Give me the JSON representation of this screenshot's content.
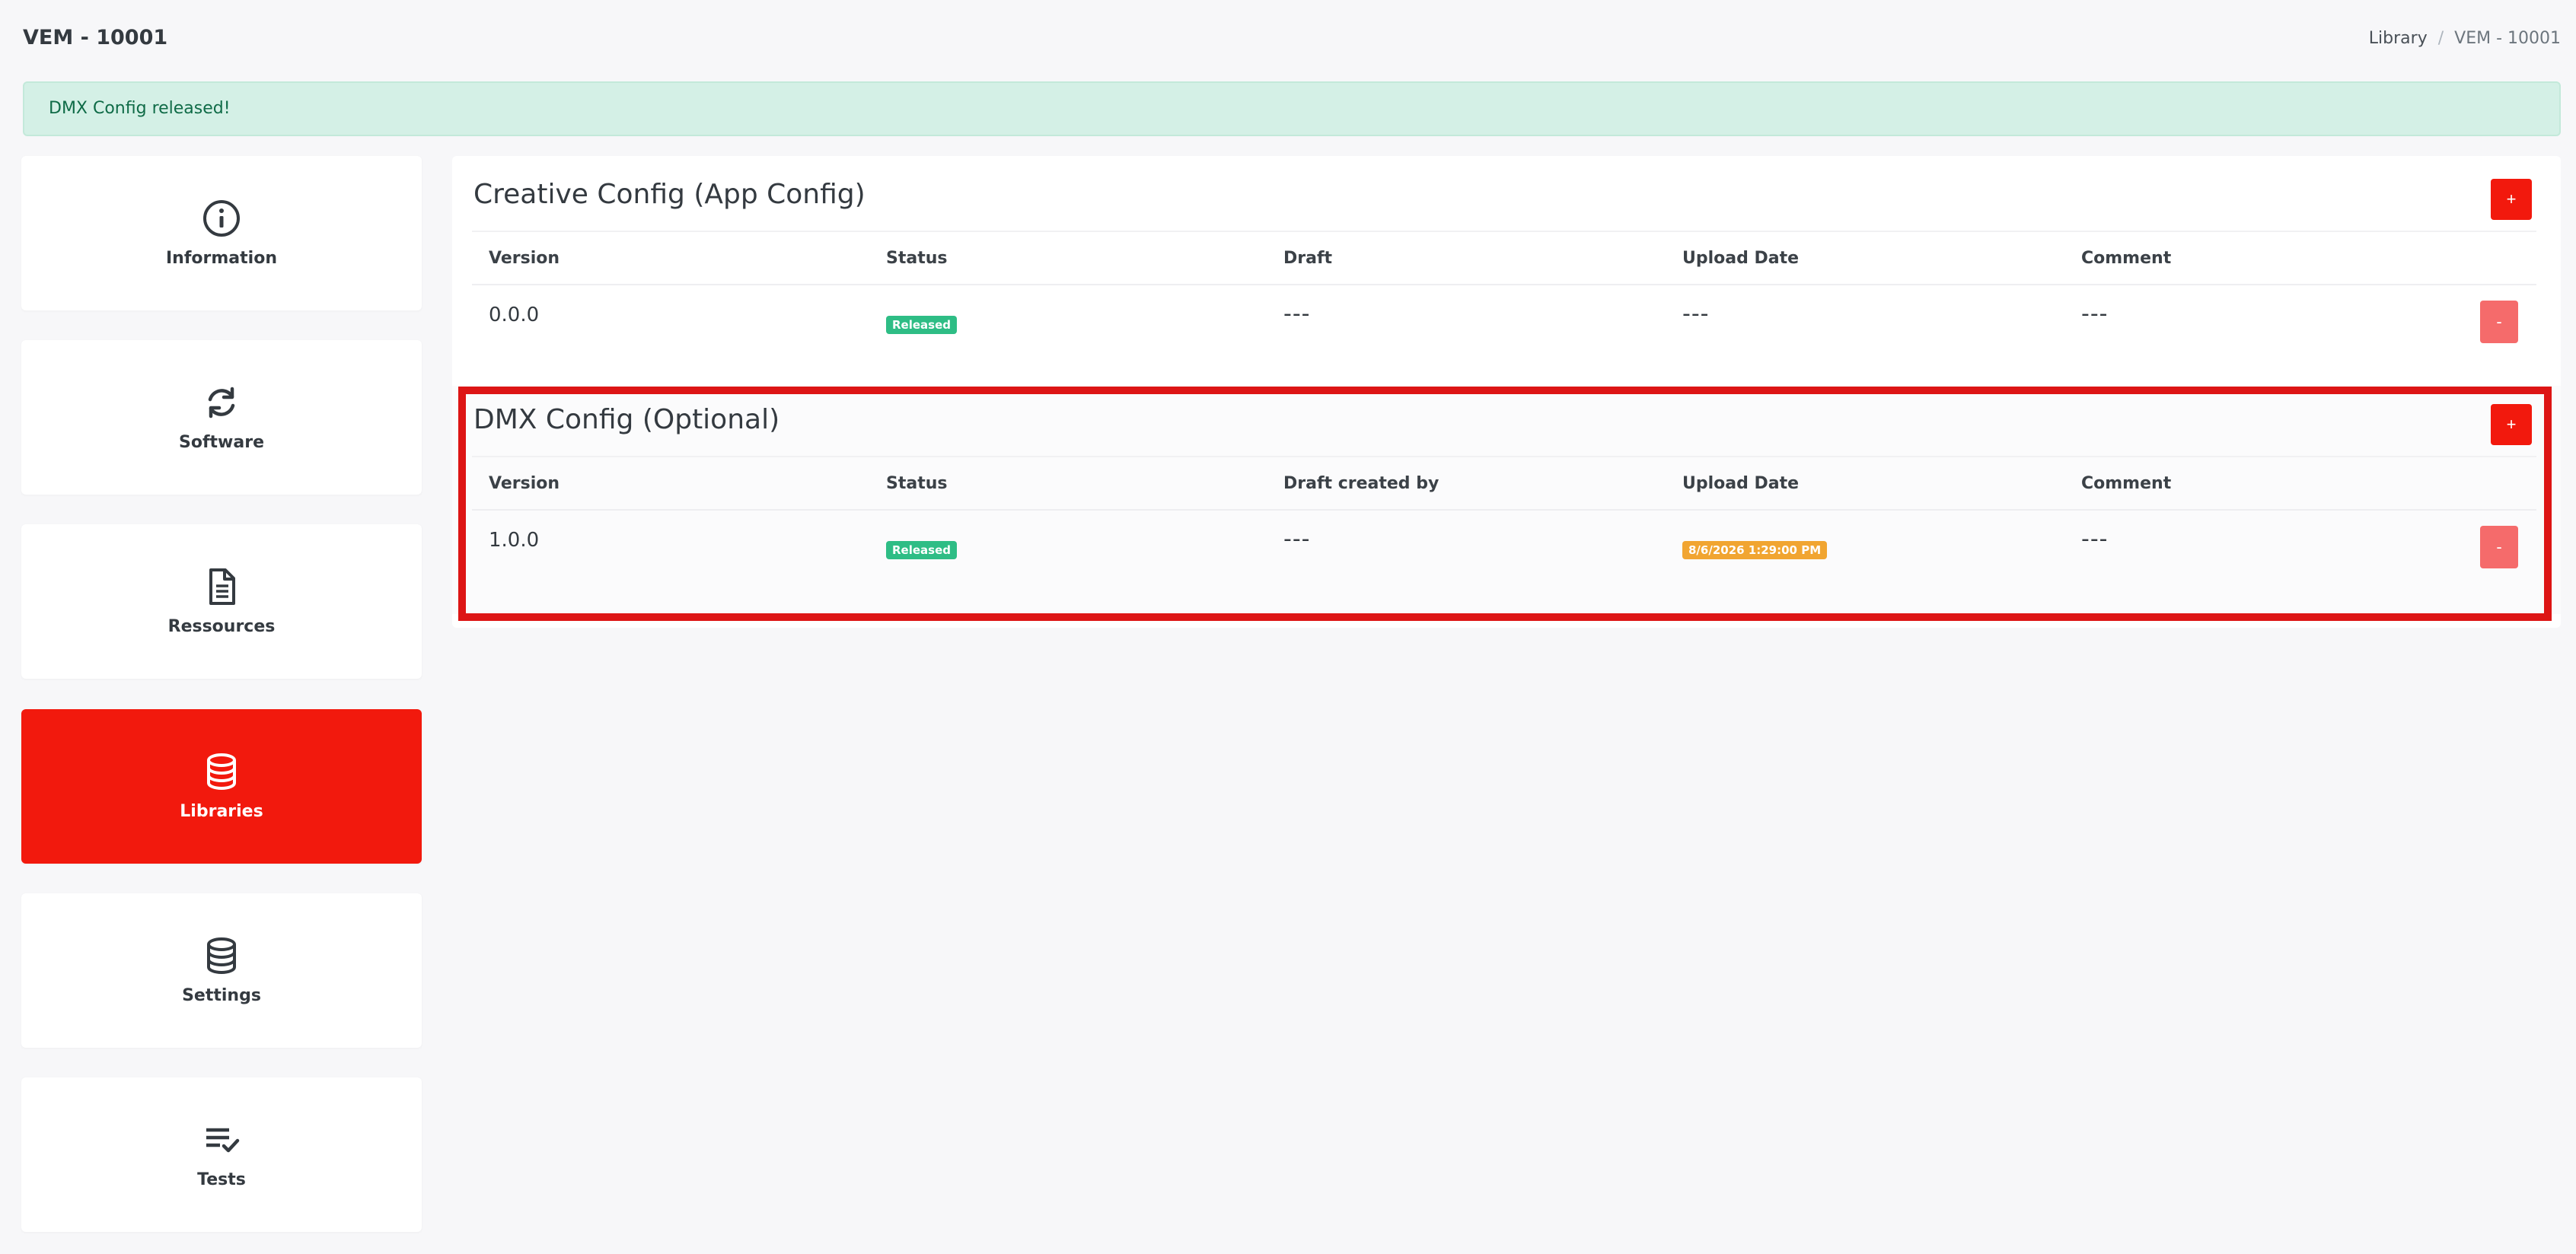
{
  "header": {
    "title": "VEM - 10001",
    "breadcrumb": [
      "Library",
      "VEM - 10001"
    ],
    "separator": "/"
  },
  "alert": {
    "text": "DMX Config released!"
  },
  "sidebar": {
    "items": [
      {
        "label": "Information",
        "icon": "info-circle-icon",
        "active": false
      },
      {
        "label": "Software",
        "icon": "sync-icon",
        "active": false
      },
      {
        "label": "Ressources",
        "icon": "file-document-icon",
        "active": false
      },
      {
        "label": "Libraries",
        "icon": "database-icon",
        "active": true
      },
      {
        "label": "Settings",
        "icon": "database-icon",
        "active": false
      },
      {
        "label": "Tests",
        "icon": "checklist-icon",
        "active": false
      }
    ]
  },
  "sections": [
    {
      "title": "Creative Config (App Config)",
      "add_label": "+",
      "columns": [
        "Version",
        "Status",
        "Draft",
        "Upload Date",
        "Comment"
      ],
      "rows": [
        {
          "version": "0.0.0",
          "status": "Released",
          "draft": "---",
          "upload_date": "---",
          "comment": "---",
          "remove_label": "-"
        }
      ]
    },
    {
      "title": "DMX Config (Optional)",
      "add_label": "+",
      "columns": [
        "Version",
        "Status",
        "Draft created by",
        "Upload Date",
        "Comment"
      ],
      "rows": [
        {
          "version": "1.0.0",
          "status": "Released",
          "draft": "---",
          "upload_date": "8/6/2026 1:29:00 PM",
          "comment": "---",
          "remove_label": "-"
        }
      ]
    }
  ],
  "colors": {
    "accent": "#f2190d",
    "success_badge": "#2ebd85",
    "date_badge": "#f1a531",
    "highlight": "#dd1515",
    "alert_bg": "#d4f0e6"
  }
}
